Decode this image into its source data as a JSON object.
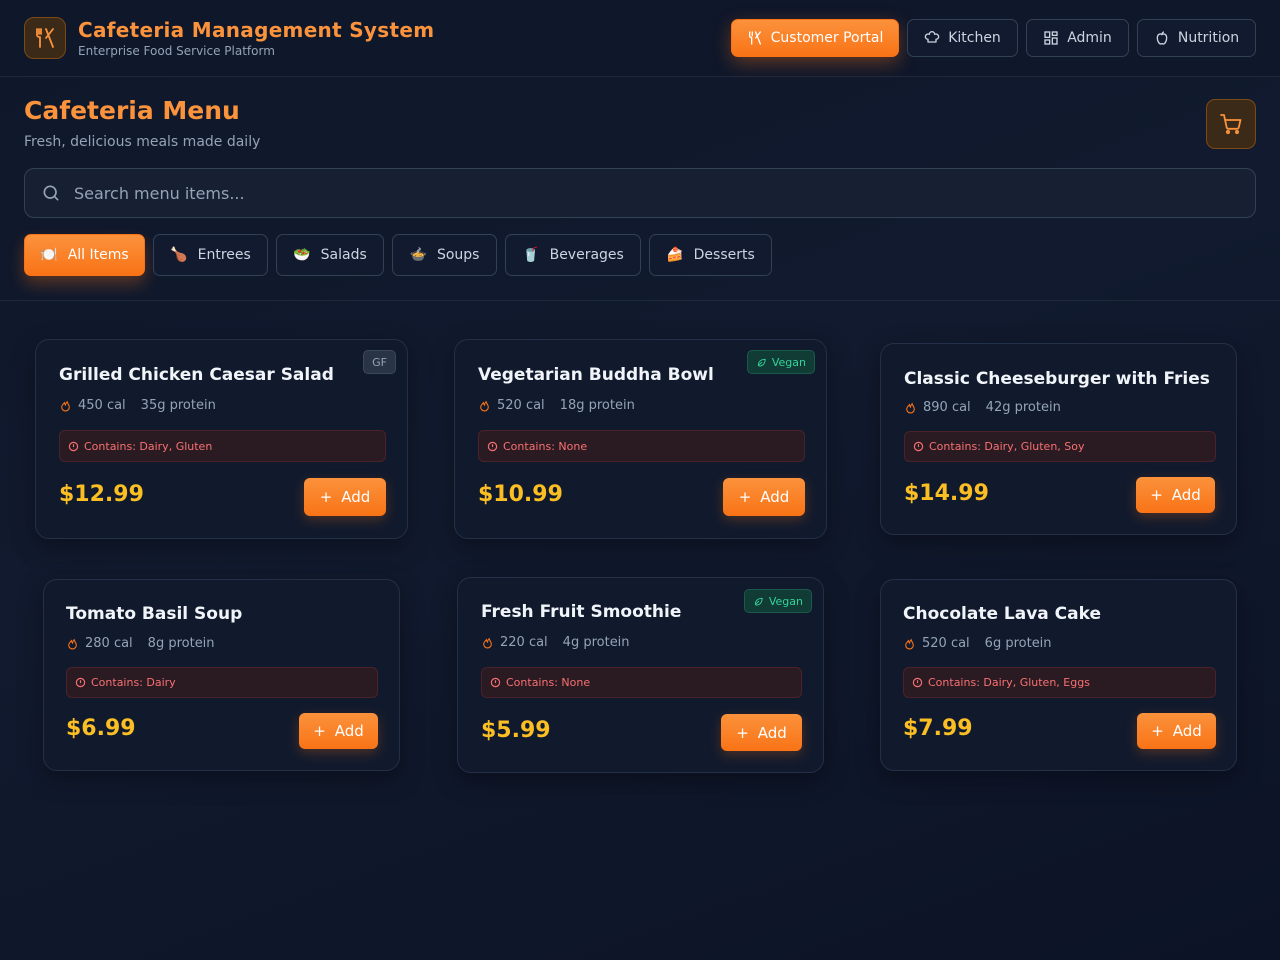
{
  "app": {
    "title": "Cafeteria Management System",
    "subtitle": "Enterprise Food Service Platform"
  },
  "nav": [
    {
      "label": "Customer Portal",
      "icon": "utensils-icon",
      "active": true
    },
    {
      "label": "Kitchen",
      "icon": "chef-hat-icon",
      "active": false
    },
    {
      "label": "Admin",
      "icon": "grid-icon",
      "active": false
    },
    {
      "label": "Nutrition",
      "icon": "apple-icon",
      "active": false
    }
  ],
  "menu": {
    "title": "Cafeteria Menu",
    "subtitle": "Fresh, delicious meals made daily",
    "search_placeholder": "Search menu items..."
  },
  "categories": [
    {
      "label": "All Items",
      "emoji": "🍽️",
      "active": true
    },
    {
      "label": "Entrees",
      "emoji": "🍗",
      "active": false
    },
    {
      "label": "Salads",
      "emoji": "🥗",
      "active": false
    },
    {
      "label": "Soups",
      "emoji": "🍲",
      "active": false
    },
    {
      "label": "Beverages",
      "emoji": "🥤",
      "active": false
    },
    {
      "label": "Desserts",
      "emoji": "🍰",
      "active": false
    }
  ],
  "items": [
    {
      "name": "Grilled Chicken Caesar Salad",
      "calories": "450 cal",
      "protein": "35g protein",
      "allergens": "Contains: Dairy, Gluten",
      "price": "$12.99",
      "badge": "GF",
      "add_label": "Add"
    },
    {
      "name": "Vegetarian Buddha Bowl",
      "calories": "520 cal",
      "protein": "18g protein",
      "allergens": "Contains: None",
      "price": "$10.99",
      "badge": "Vegan",
      "add_label": "Add"
    },
    {
      "name": "Classic Cheeseburger with Fries",
      "calories": "890 cal",
      "protein": "42g protein",
      "allergens": "Contains: Dairy, Gluten, Soy",
      "price": "$14.99",
      "badge": "",
      "add_label": "Add"
    },
    {
      "name": "Tomato Basil Soup",
      "calories": "280 cal",
      "protein": "8g protein",
      "allergens": "Contains: Dairy",
      "price": "$6.99",
      "badge": "",
      "add_label": "Add"
    },
    {
      "name": "Fresh Fruit Smoothie",
      "calories": "220 cal",
      "protein": "4g protein",
      "allergens": "Contains: None",
      "price": "$5.99",
      "badge": "Vegan",
      "add_label": "Add"
    },
    {
      "name": "Chocolate Lava Cake",
      "calories": "520 cal",
      "protein": "6g protein",
      "allergens": "Contains: Dairy, Gluten, Eggs",
      "price": "$7.99",
      "badge": "",
      "add_label": "Add"
    }
  ],
  "colors": {
    "accent": "#f97316",
    "price": "#fbbf24",
    "allergen": "#f87171",
    "vegan": "#34d399"
  }
}
